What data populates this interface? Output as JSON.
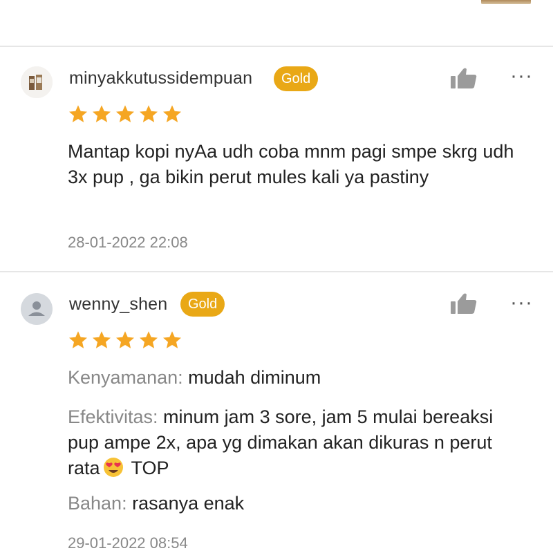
{
  "reviews": [
    {
      "username": "minyakkutussidempuan",
      "badge": "Gold",
      "rating": 5,
      "text": "Mantap kopi nyAa udh coba mnm pagi smpe skrg udh 3x pup , ga bikin perut mules kali ya pastiny",
      "date": "28-01-2022 22:08",
      "more_label": "···"
    },
    {
      "username": "wenny_shen",
      "badge": "Gold",
      "rating": 5,
      "attributes": [
        {
          "label": "Kenyamanan:",
          "value": " mudah diminum"
        },
        {
          "label": "Efektivitas:",
          "value": " minum jam 3 sore, jam 5 mulai bereaksi pup ampe 2x, apa yg dimakan akan dikuras n perut rata",
          "suffix": " TOP"
        },
        {
          "label": "Bahan:",
          "value": " rasanya enak"
        }
      ],
      "date": "29-01-2022 08:54",
      "more_label": "···"
    }
  ],
  "colors": {
    "gold_badge": "#e9a816",
    "star": "#f5a623",
    "muted_text": "#888888",
    "divider": "#e6e6e6"
  },
  "icons": {
    "like": "thumbs-up-icon",
    "more": "more-options-icon",
    "star": "star-icon",
    "emoji": "heart-eyes-emoji"
  }
}
